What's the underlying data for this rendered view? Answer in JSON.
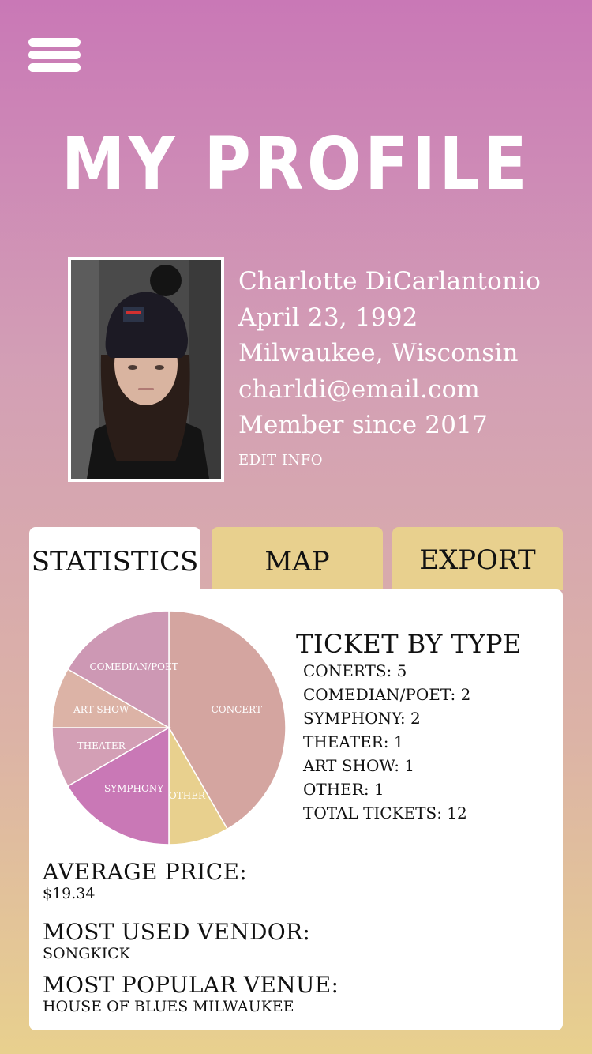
{
  "header": {
    "title": "MY PROFILE",
    "menu_icon": "hamburger-menu-icon"
  },
  "profile": {
    "name": "Charlotte DiCarlantonio",
    "birthdate": "April 23, 1992",
    "location": "Milwaukee, Wisconsin",
    "email": "charldi@email.com",
    "member_since": "Member since 2017",
    "edit_label": "EDIT INFO"
  },
  "tabs": [
    {
      "label": "STATISTICS"
    },
    {
      "label": "MAP"
    },
    {
      "label": "EXPORT"
    }
  ],
  "colors": {
    "concert": "#d4a5a0",
    "other": "#e8d08e",
    "symphony": "#c978b6",
    "theater": "#d39fb5",
    "art_show": "#dcb3a6",
    "comedian": "#cd98b4"
  },
  "chart_data": {
    "type": "pie",
    "categories": [
      "CONCERT",
      "OTHER",
      "SYMPHONY",
      "THEATER",
      "ART SHOW",
      "COMEDIAN/POET"
    ],
    "values": [
      5,
      1,
      2,
      1,
      1,
      2
    ]
  },
  "statistics": {
    "ticket_title": "TICKET BY TYPE",
    "ticket_rows": [
      "CONERTS: 5",
      "COMEDIAN/POET: 2",
      "SYMPHONY: 2",
      "THEATER: 1",
      "ART SHOW: 1",
      "OTHER: 1",
      "TOTAL TICKETS: 12"
    ],
    "avg_price_label": "AVERAGE PRICE:",
    "avg_price_value": "$19.34",
    "vendor_label": "MOST USED VENDOR:",
    "vendor_value": "SONGKICK",
    "venue_label": "MOST POPULAR VENUE:",
    "venue_value": "HOUSE OF BLUES MILWAUKEE"
  }
}
